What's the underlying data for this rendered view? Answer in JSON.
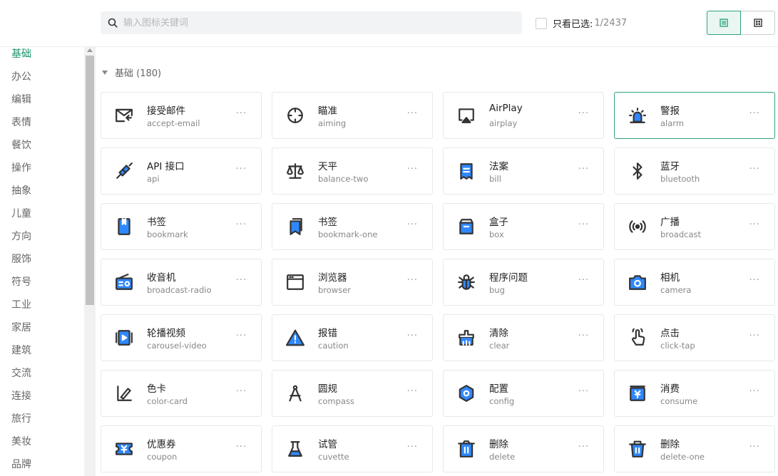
{
  "search": {
    "placeholder": "输入图标关键词"
  },
  "filter": {
    "only_selected_label": "只看已选:",
    "selected_count": "1/2437"
  },
  "sidebar": {
    "items": [
      "基础",
      "办公",
      "编辑",
      "表情",
      "餐饮",
      "操作",
      "抽象",
      "儿童",
      "方向",
      "服饰",
      "符号",
      "工业",
      "家居",
      "建筑",
      "交流",
      "连接",
      "旅行",
      "美妆",
      "品牌"
    ],
    "active_index": 0
  },
  "group": {
    "title": "基础 (180)"
  },
  "colors": {
    "accent": "#17936b",
    "icon_blue": "#2f88ff",
    "icon_stroke": "#333333"
  },
  "icons": [
    {
      "zh": "接受邮件",
      "en": "accept-email",
      "icon": "accept-email-icon"
    },
    {
      "zh": "瞄准",
      "en": "aiming",
      "icon": "aiming-icon"
    },
    {
      "zh": "AirPlay",
      "en": "airplay",
      "icon": "airplay-icon"
    },
    {
      "zh": "警报",
      "en": "alarm",
      "icon": "alarm-icon",
      "selected": true
    },
    {
      "zh": "API 接口",
      "en": "api",
      "icon": "api-icon"
    },
    {
      "zh": "天平",
      "en": "balance-two",
      "icon": "balance-icon"
    },
    {
      "zh": "法案",
      "en": "bill",
      "icon": "bill-icon"
    },
    {
      "zh": "蓝牙",
      "en": "bluetooth",
      "icon": "bluetooth-icon"
    },
    {
      "zh": "书签",
      "en": "bookmark",
      "icon": "bookmark-icon"
    },
    {
      "zh": "书签",
      "en": "bookmark-one",
      "icon": "bookmark-one-icon"
    },
    {
      "zh": "盒子",
      "en": "box",
      "icon": "box-icon"
    },
    {
      "zh": "广播",
      "en": "broadcast",
      "icon": "broadcast-icon"
    },
    {
      "zh": "收音机",
      "en": "broadcast-radio",
      "icon": "radio-icon"
    },
    {
      "zh": "浏览器",
      "en": "browser",
      "icon": "browser-icon"
    },
    {
      "zh": "程序问题",
      "en": "bug",
      "icon": "bug-icon"
    },
    {
      "zh": "相机",
      "en": "camera",
      "icon": "camera-icon"
    },
    {
      "zh": "轮播视频",
      "en": "carousel-video",
      "icon": "carousel-video-icon"
    },
    {
      "zh": "报错",
      "en": "caution",
      "icon": "caution-icon"
    },
    {
      "zh": "清除",
      "en": "clear",
      "icon": "clear-icon"
    },
    {
      "zh": "点击",
      "en": "click-tap",
      "icon": "click-tap-icon"
    },
    {
      "zh": "色卡",
      "en": "color-card",
      "icon": "color-card-icon"
    },
    {
      "zh": "圆规",
      "en": "compass",
      "icon": "compass-icon"
    },
    {
      "zh": "配置",
      "en": "config",
      "icon": "config-icon"
    },
    {
      "zh": "消费",
      "en": "consume",
      "icon": "consume-icon"
    },
    {
      "zh": "优惠券",
      "en": "coupon",
      "icon": "coupon-icon"
    },
    {
      "zh": "试管",
      "en": "cuvette",
      "icon": "cuvette-icon"
    },
    {
      "zh": "删除",
      "en": "delete",
      "icon": "delete-icon"
    },
    {
      "zh": "删除",
      "en": "delete-one",
      "icon": "delete-one-icon"
    }
  ],
  "more_glyph": "···"
}
